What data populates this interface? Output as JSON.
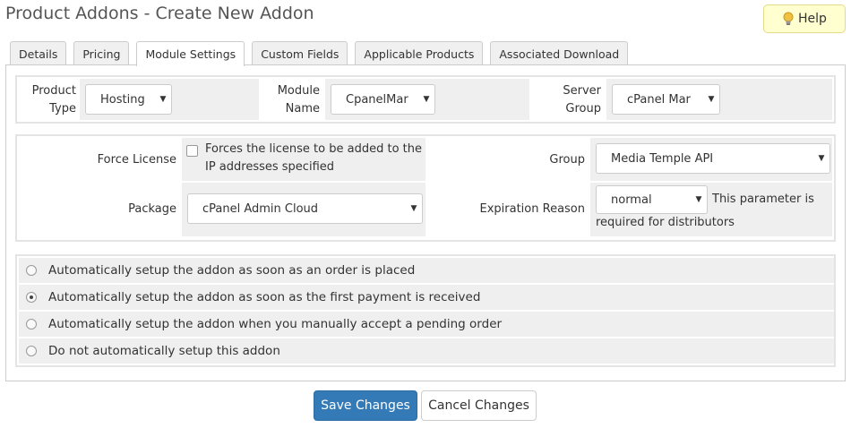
{
  "header": {
    "title": "Product Addons - Create New Addon",
    "help_label": "Help"
  },
  "tabs": [
    {
      "label": "Details"
    },
    {
      "label": "Pricing"
    },
    {
      "label": "Module Settings"
    },
    {
      "label": "Custom Fields"
    },
    {
      "label": "Applicable Products"
    },
    {
      "label": "Associated Download"
    }
  ],
  "active_tab": "Module Settings",
  "module_row": {
    "product_type": {
      "label_line1": "Product",
      "label_line2": "Type",
      "value": "Hosting"
    },
    "module_name": {
      "label_line1": "Module",
      "label_line2": "Name",
      "value": "CpanelMar"
    },
    "server_group": {
      "label_line1": "Server",
      "label_line2": "Group",
      "value": "cPanel Mar"
    }
  },
  "settings": {
    "force_license": {
      "label": "Force License",
      "checked": false,
      "desc_line1": "Forces the license to be added to the",
      "desc_line2": "IP addresses specified"
    },
    "group": {
      "label": "Group",
      "value": "Media Temple API"
    },
    "package": {
      "label": "Package",
      "value": "cPanel Admin Cloud"
    },
    "expiration_reason": {
      "label": "Expiration Reason",
      "value": "normal",
      "desc_line1": "This parameter is",
      "desc_line2": "required for distributors"
    }
  },
  "setup_options": [
    {
      "label": "Automatically setup the addon as soon as an order is placed",
      "checked": false
    },
    {
      "label": "Automatically setup the addon as soon as the first payment is received",
      "checked": true
    },
    {
      "label": "Automatically setup the addon when you manually accept a pending order",
      "checked": false
    },
    {
      "label": "Do not automatically setup this addon",
      "checked": false
    }
  ],
  "footer": {
    "save_label": "Save Changes",
    "cancel_label": "Cancel Changes"
  },
  "colors": {
    "primary": "#337ab7",
    "help_bg": "#ffffd0",
    "field_bg": "#efefef"
  }
}
